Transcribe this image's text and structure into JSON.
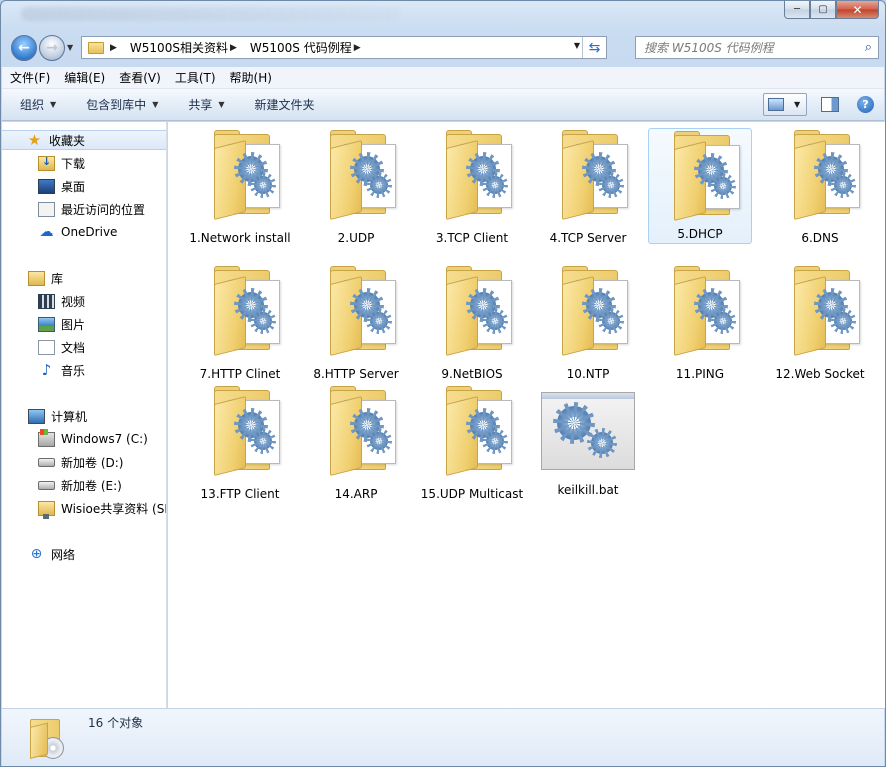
{
  "window": {
    "caption": {
      "minimize": "─",
      "maximize": "▢",
      "close": "✕"
    }
  },
  "address_bar": {
    "breadcrumbs": [
      "W5100S相关资料",
      "W5100S 代码例程"
    ]
  },
  "search": {
    "placeholder": "搜索 W5100S 代码例程"
  },
  "menu": [
    "文件(F)",
    "编辑(E)",
    "查看(V)",
    "工具(T)",
    "帮助(H)"
  ],
  "toolbar": {
    "organize": "组织",
    "include_in_library": "包含到库中",
    "share": "共享",
    "new_folder": "新建文件夹"
  },
  "sidebar": {
    "favorites": {
      "label": "收藏夹",
      "items": [
        "下载",
        "桌面",
        "最近访问的位置",
        "OneDrive"
      ]
    },
    "libraries": {
      "label": "库",
      "items": [
        "视频",
        "图片",
        "文档",
        "音乐"
      ]
    },
    "computer": {
      "label": "计算机",
      "items": [
        "Windows7 (C:)",
        "新加卷 (D:)",
        "新加卷 (E:)",
        "Wisioe共享资料 (SM"
      ]
    },
    "network": {
      "label": "网络"
    }
  },
  "files": [
    {
      "name": "1.Network install",
      "type": "folder"
    },
    {
      "name": "2.UDP",
      "type": "folder"
    },
    {
      "name": "3.TCP Client",
      "type": "folder"
    },
    {
      "name": "4.TCP Server",
      "type": "folder"
    },
    {
      "name": "5.DHCP",
      "type": "folder",
      "selected": true
    },
    {
      "name": "6.DNS",
      "type": "folder"
    },
    {
      "name": "7.HTTP Clinet",
      "type": "folder"
    },
    {
      "name": "8.HTTP Server",
      "type": "folder"
    },
    {
      "name": "9.NetBIOS",
      "type": "folder"
    },
    {
      "name": "10.NTP",
      "type": "folder"
    },
    {
      "name": "11.PING",
      "type": "folder"
    },
    {
      "name": "12.Web Socket",
      "type": "folder"
    },
    {
      "name": "13.FTP Client",
      "type": "folder"
    },
    {
      "name": "14.ARP",
      "type": "folder"
    },
    {
      "name": "15.UDP Multicast",
      "type": "folder"
    },
    {
      "name": "keilkill.bat",
      "type": "batch"
    }
  ],
  "status": {
    "item_count": "16 个对象"
  }
}
